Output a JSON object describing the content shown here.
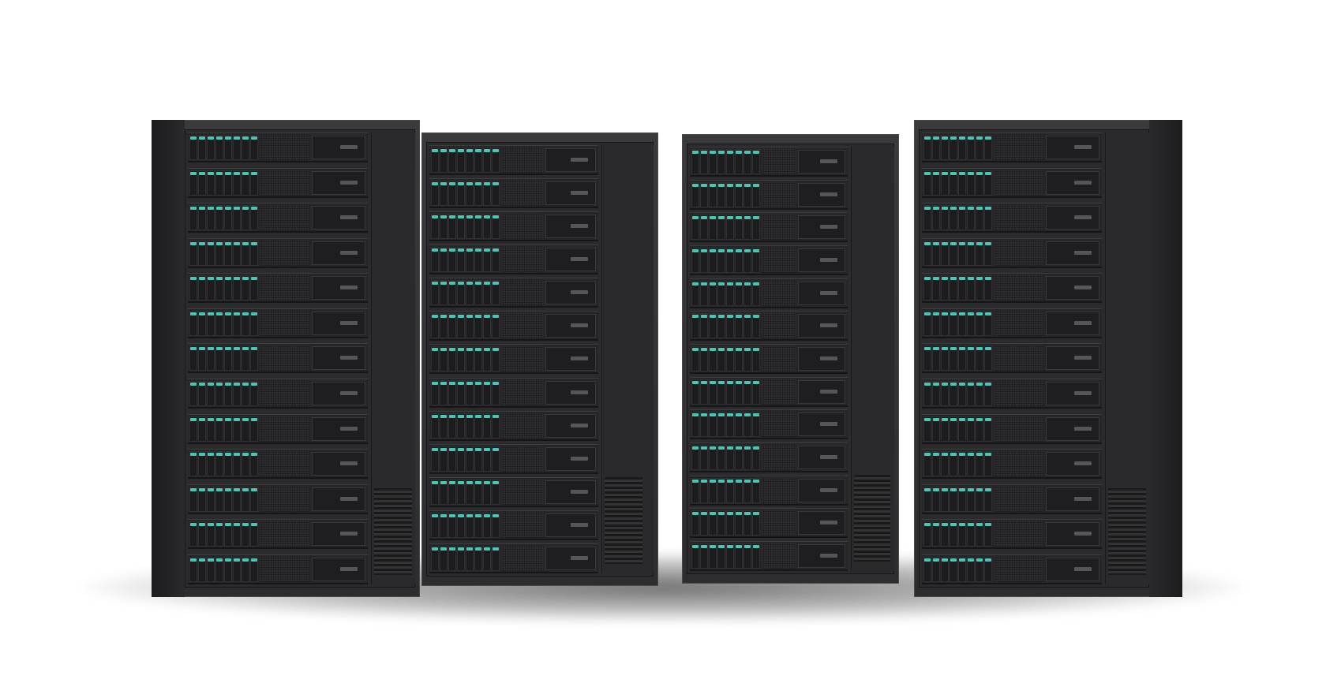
{
  "scene": {
    "subject": "server-racks",
    "rack_count": 4,
    "units_per_rack": 13,
    "colors": {
      "background": "#ffffff",
      "rack_body": "#2d2d2f",
      "rack_side": "#1c1c1e",
      "drive_led": "#47c7b4",
      "vent": "#1a1a1b"
    }
  }
}
